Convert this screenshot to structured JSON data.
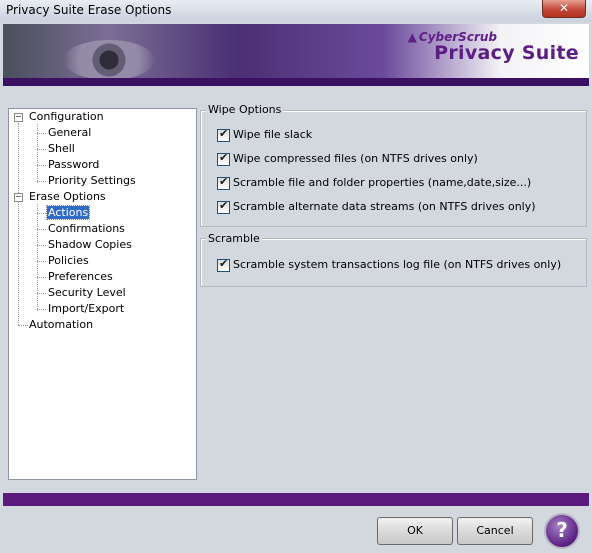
{
  "window": {
    "title": "Privacy Suite Erase Options",
    "close_label": "✕"
  },
  "banner": {
    "logo_small": "CyberScrub",
    "logo_tri": "▲",
    "logo_big": "Privacy Suite"
  },
  "tree": {
    "configuration": {
      "label": "Configuration",
      "expander": "−",
      "children": [
        "General",
        "Shell",
        "Password",
        "Priority Settings"
      ]
    },
    "erase_options": {
      "label": "Erase Options",
      "expander": "−",
      "children": [
        "Actions",
        "Confirmations",
        "Shadow Copies",
        "Policies",
        "Preferences",
        "Security Level",
        "Import/Export"
      ]
    },
    "automation": {
      "label": "Automation"
    },
    "selected": "Actions"
  },
  "wipe_options": {
    "label": "Wipe Options",
    "items": [
      {
        "label": "Wipe file slack",
        "checked": true
      },
      {
        "label": "Wipe compressed files (on NTFS drives only)",
        "checked": true
      },
      {
        "label": "Scramble file and folder properties (name,date,size...)",
        "checked": true
      },
      {
        "label": "Scramble alternate data streams (on NTFS drives only)",
        "checked": true
      }
    ]
  },
  "scramble": {
    "label": "Scramble",
    "items": [
      {
        "label": "Scramble system transactions log file (on NTFS drives only)",
        "checked": true
      }
    ]
  },
  "buttons": {
    "ok": "OK",
    "cancel": "Cancel",
    "help": "?"
  },
  "colors": {
    "accent_purple": "#5a1a7e",
    "selection_blue": "#316ac5"
  }
}
